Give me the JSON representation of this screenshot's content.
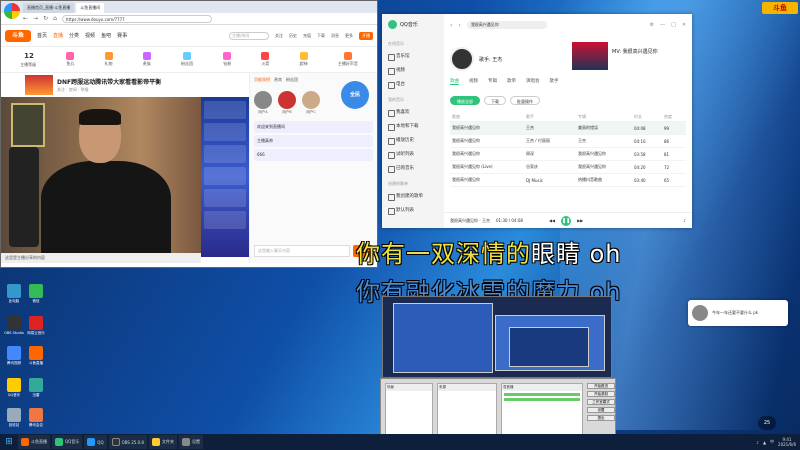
{
  "badge": "斗鱼",
  "browser": {
    "tabs": [
      "直播首页_直播·斗鱼直播",
      "斗鱼直播间"
    ],
    "url": "https://www.douyu.com/7777",
    "menu": [
      "首页",
      "直播",
      "分类",
      "视频",
      "鱼吧",
      "赛事"
    ],
    "search_placeholder": "主播/房间",
    "header_btns": [
      "关注",
      "历史",
      "充值",
      "下载",
      "消息",
      "更多"
    ],
    "open_live": "开播",
    "cats": [
      {
        "label": "12",
        "sub": "主播等级"
      },
      {
        "label": "鱼丸"
      },
      {
        "label": "礼物"
      },
      {
        "label": "贵族"
      },
      {
        "label": "粉丝团"
      },
      {
        "label": "钻粉"
      },
      {
        "label": "火箭"
      },
      {
        "label": "超神"
      },
      {
        "label": "主播好声音"
      }
    ],
    "room_title": "DNF跨服运动腾讯带大家看看影帝平衡",
    "room_sub": "关注 · 房间 · 举报",
    "video_bar": "这里是主播分享的内容",
    "side_tabs": [
      "贡献周榜",
      "贵宾",
      "粉丝团"
    ],
    "avatars": [
      "用户A",
      "用户B",
      "用户C"
    ],
    "chats": [
      "欢迎来到直播间",
      "主播真帅",
      "666"
    ],
    "chat_placeholder": "这里输入聊天内容",
    "send": "发送",
    "zhuanyu": "全民"
  },
  "qq": {
    "title": "QQ音乐",
    "search": "我很高兴遇见你",
    "side": [
      {
        "sec": "在线音乐",
        "items": [
          "音乐馆",
          "视频",
          "电台"
        ]
      },
      {
        "sec": "我的音乐",
        "items": [
          "我喜欢",
          "本地和下载",
          "播放历史",
          "试听列表",
          "已购音乐"
        ]
      },
      {
        "sec": "创建的歌单",
        "items": [
          "我创建的歌单",
          "默认列表"
        ]
      }
    ],
    "singer": "歌手: 王杰",
    "mv": "MV: 我很高兴遇见你",
    "tabs": [
      "歌曲",
      "视频",
      "专辑",
      "歌单",
      "演唱会",
      "歌手"
    ],
    "actions": [
      "播放全部",
      "下载",
      "批量操作"
    ],
    "cols": [
      "歌曲",
      "歌手",
      "专辑",
      "时长",
      "热度"
    ],
    "rows": [
      [
        "我很高兴遇见你",
        "王杰",
        "美丽的错误",
        "04:08",
        "99"
      ],
      [
        "我很高兴遇见你",
        "王杰 / 付丽丽",
        "王杰",
        "04:10",
        "86"
      ],
      [
        "我很高兴遇见你",
        "周深",
        "我很高兴遇见你",
        "03:58",
        "81"
      ],
      [
        "我很高兴遇见你 (Live)",
        "谷家庆",
        "我很高兴遇见你",
        "04:20",
        "72"
      ],
      [
        "我很高兴遇见你",
        "DJ Music",
        "热播抖音歌曲",
        "03:40",
        "65"
      ]
    ],
    "now_playing": "我很高兴遇见你 - 王杰",
    "time": "01:30 / 04:08"
  },
  "lyrics": {
    "line1_done": "你有一双深情的",
    "line1_rest": "眼睛 oh",
    "line2": "你有融化冰雪的魔力 oh"
  },
  "desktop_icons": [
    "此电脑",
    "微信",
    "OBS Studio",
    "网易云音乐",
    "腾讯视频",
    "斗鱼直播",
    "QQ音乐",
    "迅雷",
    "回收站",
    "腾讯会议"
  ],
  "notif": "今年一年还要不要什么 pk",
  "clock_badge": "25",
  "taskbar": {
    "tasks": [
      "斗鱼直播",
      "QQ音乐",
      "QQ",
      "OBS 25.0.8",
      "文件夹",
      "设置"
    ],
    "time": "9:41",
    "date": "2021/6/6",
    "ime": "中"
  },
  "obs": {
    "scenes": "场景",
    "sources": "来源",
    "mixer": "混音器",
    "buttons": [
      "开始推流",
      "开始录制",
      "工作室模式",
      "设置",
      "退出"
    ]
  }
}
